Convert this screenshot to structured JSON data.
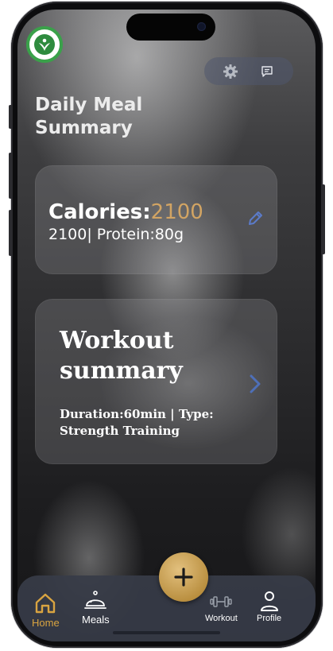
{
  "header": {
    "title_line1": "Daily Meal",
    "title_line2": "Summary",
    "logo_icon": "leaf-person-logo",
    "actions": [
      {
        "icon": "gear-icon"
      },
      {
        "icon": "chat-icon"
      }
    ]
  },
  "calories_card": {
    "calories_label": "Calories:",
    "calories_value": "2100",
    "second_line": "2100| Protein:80g",
    "edit_icon": "pencil-icon",
    "accent_color": "#d2a463"
  },
  "workout_card": {
    "title_line1": "Workout",
    "title_line2": "summary",
    "details_line1": "Duration:60min | Type:",
    "details_line2": "Strength Training",
    "chevron_icon": "chevron-right-icon"
  },
  "tabbar": {
    "tabs": [
      {
        "label": "Home",
        "icon": "home-icon",
        "active": true
      },
      {
        "label": "Meals",
        "icon": "cloche-icon",
        "active": false
      },
      {
        "label": "Workout",
        "icon": "dumbbell-icon",
        "active": false
      },
      {
        "label": "Profile",
        "icon": "person-icon",
        "active": false
      }
    ],
    "add_button_icon": "plus-icon",
    "active_color": "#d9a441"
  }
}
